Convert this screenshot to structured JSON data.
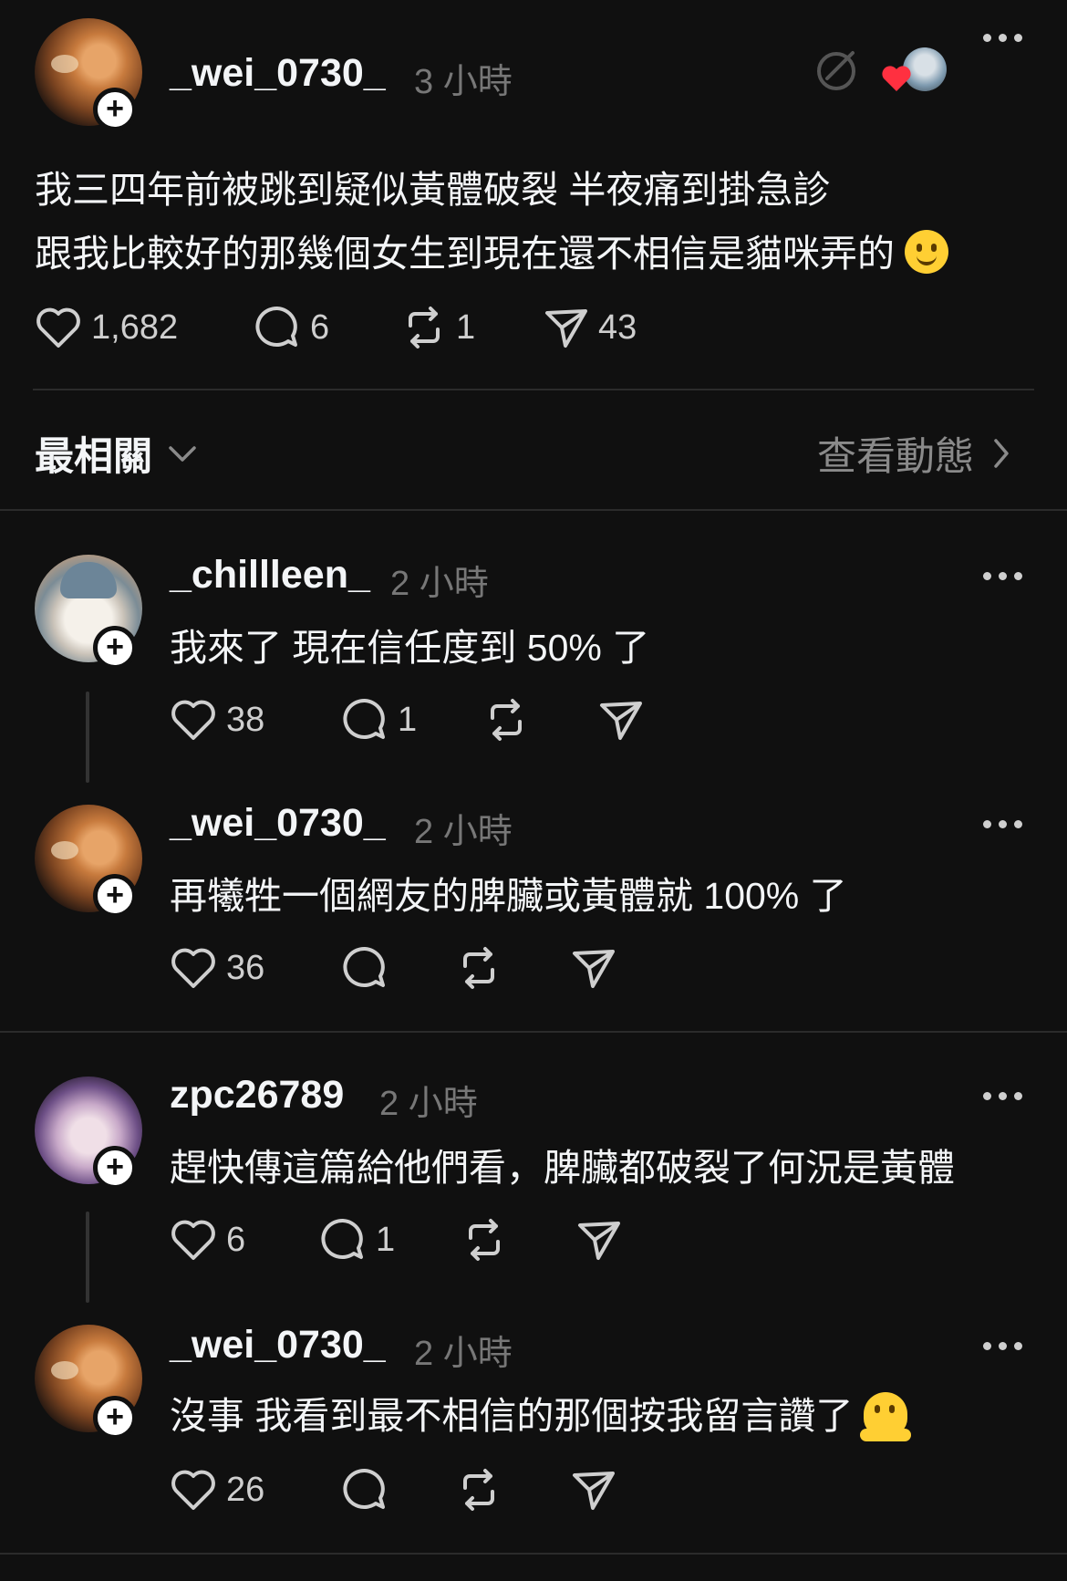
{
  "post": {
    "username": "_wei_0730_",
    "time": "3 小時",
    "line1": "我三四年前被跳到疑似黃體破裂 半夜痛到掛急診",
    "line2": "跟我比較好的那幾個女生到現在還不相信是貓咪弄的",
    "line2_emoji": "slightly-smiling-face",
    "likes": "1,682",
    "comments": "6",
    "reposts": "1",
    "shares": "43"
  },
  "sort_bar": {
    "label": "最相關",
    "activity_link": "查看動態"
  },
  "replies": [
    {
      "username": "_chillleen_",
      "time": "2 小時",
      "text": "我來了 現在信任度到 50% 了",
      "likes": "38",
      "comments": "1",
      "reposts": "",
      "shares": ""
    },
    {
      "username": "_wei_0730_",
      "time": "2 小時",
      "text": "再犧牲一個網友的脾臟或黃體就 100% 了",
      "likes": "36",
      "comments": "",
      "reposts": "",
      "shares": ""
    },
    {
      "username": "zpc26789",
      "time": "2 小時",
      "text": "趕快傳這篇給他們看，脾臟都破裂了何況是黃體",
      "likes": "6",
      "comments": "1",
      "reposts": "",
      "shares": ""
    },
    {
      "username": "_wei_0730_",
      "time": "2 小時",
      "text": "沒事 我看到最不相信的那個按我留言讚了",
      "text_emoji": "melting-face",
      "likes": "26",
      "comments": "",
      "reposts": "",
      "shares": ""
    }
  ],
  "colors": {
    "background": "#101010",
    "text": "#f3f5f7",
    "muted": "#777777",
    "heart": "#ff3040"
  }
}
